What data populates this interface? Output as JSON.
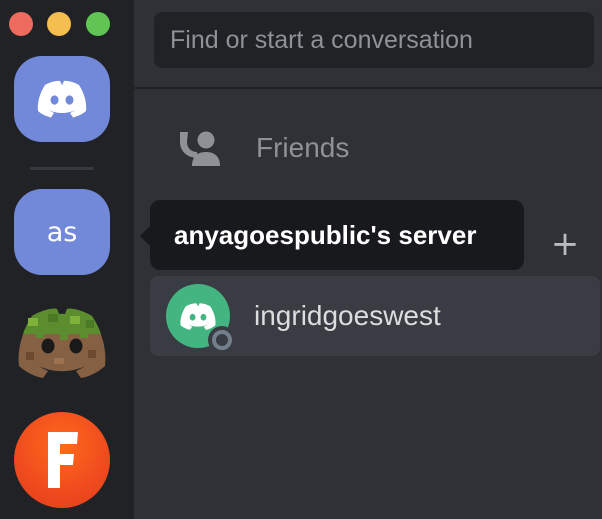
{
  "window": {
    "controls": [
      "close",
      "minimize",
      "zoom"
    ]
  },
  "servers": [
    {
      "id": "home",
      "icon": "discord-logo-icon",
      "color": "#7289da"
    },
    {
      "id": "as",
      "initials": "as",
      "color": "#7289da"
    },
    {
      "id": "minecraft",
      "icon": "minecraft-grass-discord-icon"
    },
    {
      "id": "fortnite",
      "icon": "fortnite-f-icon",
      "color": "#f04d1e"
    }
  ],
  "search": {
    "placeholder": "Find or start a conversation"
  },
  "nav": {
    "friends_label": "Friends"
  },
  "direct_messages": {
    "add_label": "+",
    "items": [
      {
        "name": "ingridgoeswest",
        "status": "offline",
        "avatar_color": "#43b581"
      }
    ]
  },
  "tooltip": {
    "text": "anyagoespublic's server"
  },
  "colors": {
    "rail_bg": "#202225",
    "main_bg": "#2f3136",
    "blurple": "#7289da",
    "green": "#43b581",
    "tooltip_bg": "#18191c"
  }
}
